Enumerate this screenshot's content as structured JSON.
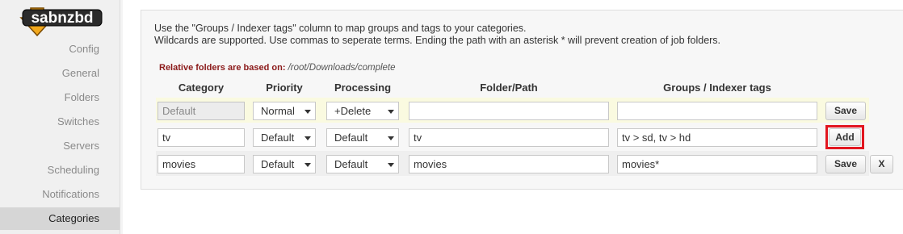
{
  "logo": {
    "text": "sabnzbd"
  },
  "sidebar": {
    "items": [
      {
        "label": "Config"
      },
      {
        "label": "General"
      },
      {
        "label": "Folders"
      },
      {
        "label": "Switches"
      },
      {
        "label": "Servers"
      },
      {
        "label": "Scheduling"
      },
      {
        "label": "Notifications"
      },
      {
        "label": "Categories"
      }
    ]
  },
  "intro": {
    "line1": "Use the \"Groups / Indexer tags\" column to map groups and tags to your categories.",
    "line2": "Wildcards are supported. Use commas to seperate terms. Ending the path with an asterisk * will prevent creation of job folders."
  },
  "relative": {
    "label": "Relative folders are based on:",
    "path": "/root/Downloads/complete"
  },
  "columns": {
    "category": "Category",
    "priority": "Priority",
    "processing": "Processing",
    "folder": "Folder/Path",
    "groups": "Groups / Indexer tags"
  },
  "rows": [
    {
      "category": "Default",
      "priority": "Normal",
      "processing": "+Delete",
      "folder": "",
      "groups": "",
      "button": "Save"
    },
    {
      "category": "tv",
      "priority": "Default",
      "processing": "Default",
      "folder": "tv",
      "groups": "tv > sd, tv > hd",
      "button": "Add"
    },
    {
      "category": "movies",
      "priority": "Default",
      "processing": "Default",
      "folder": "movies",
      "groups": "movies*",
      "button": "Save",
      "delete": "X"
    }
  ],
  "colors": {
    "highlight": "#e2161f",
    "default_row": "#fafae0",
    "relative_label": "#8b1a1a"
  }
}
